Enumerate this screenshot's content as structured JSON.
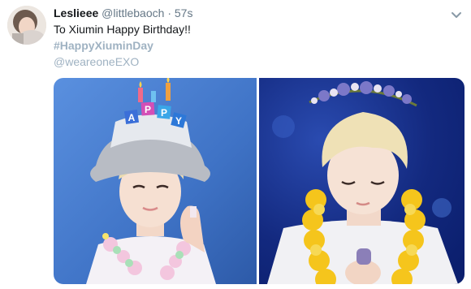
{
  "tweet": {
    "author_name": "Leslieee",
    "author_handle": "@littlebaoch",
    "separator": "·",
    "timestamp": "57s",
    "text": "To Xiumin Happy Birthday!!",
    "hashtag": "#HappyXiuminDay",
    "mention": "@weareoneEXO"
  },
  "hat_letters": [
    "A",
    "P",
    "P",
    "Y"
  ],
  "colors": {
    "text_primary": "#14171a",
    "text_secondary": "#657786",
    "link_faded": "#9fb2c2",
    "left_photo_bg": "#3f73c6",
    "right_photo_bg": "#0b1f6e"
  },
  "icons": {
    "menu": "chevron-down-icon"
  }
}
